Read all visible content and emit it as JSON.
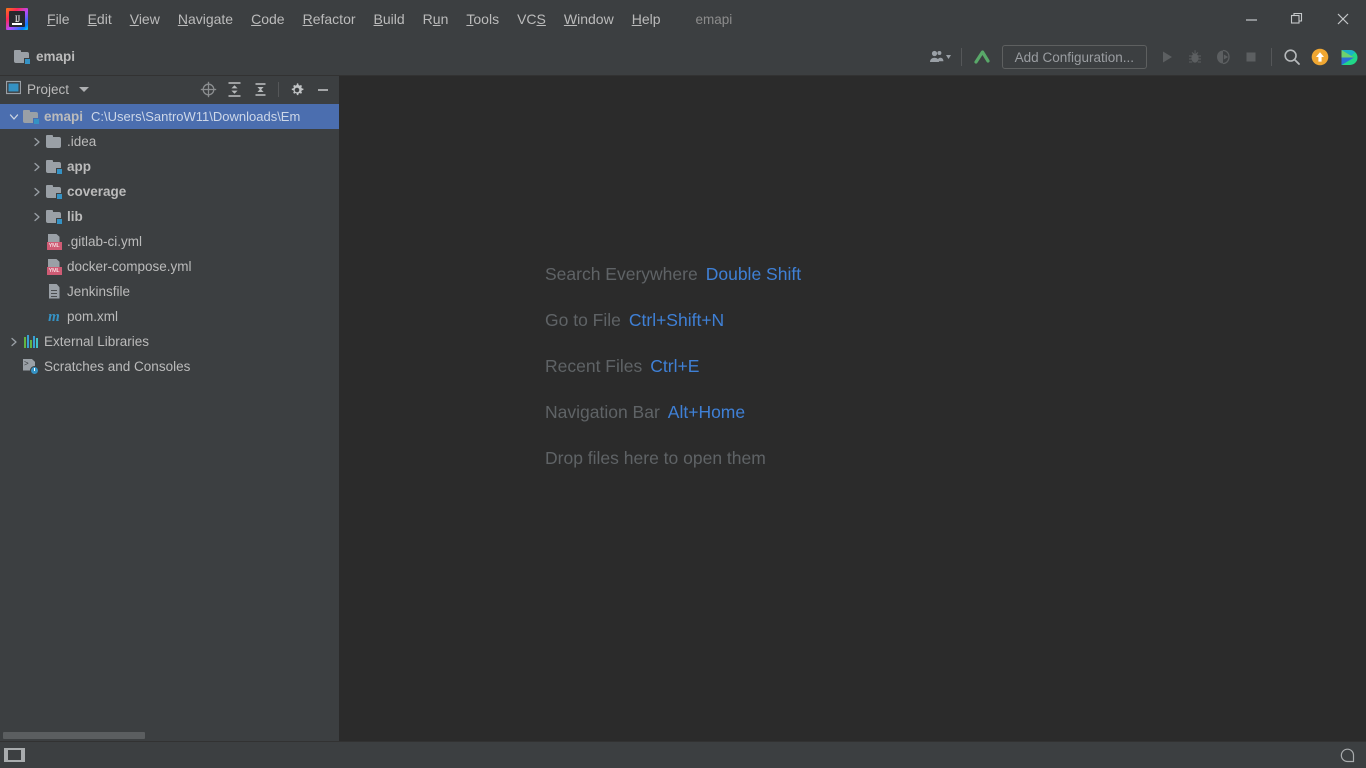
{
  "window": {
    "title": "emapi",
    "controls": [
      {
        "name": "minimize-button",
        "icon": "minimize-icon"
      },
      {
        "name": "restore-button",
        "icon": "restore-icon"
      },
      {
        "name": "close-button",
        "icon": "close-icon"
      }
    ]
  },
  "menubar": {
    "logo_alt": "intellij-idea-logo",
    "items": [
      {
        "label": "File",
        "mnemonic": "F"
      },
      {
        "label": "Edit",
        "mnemonic": "E"
      },
      {
        "label": "View",
        "mnemonic": "V"
      },
      {
        "label": "Navigate",
        "mnemonic": "N"
      },
      {
        "label": "Code",
        "mnemonic": "C"
      },
      {
        "label": "Refactor",
        "mnemonic": "R"
      },
      {
        "label": "Build",
        "mnemonic": "B"
      },
      {
        "label": "Run",
        "mnemonic": "u"
      },
      {
        "label": "Tools",
        "mnemonic": "T"
      },
      {
        "label": "VCS",
        "mnemonic": "S"
      },
      {
        "label": "Window",
        "mnemonic": "W"
      },
      {
        "label": "Help",
        "mnemonic": "H"
      }
    ]
  },
  "toolbar": {
    "project_chip_label": "emapi",
    "profile_icon": "user-profile-icon",
    "vcs_update_icon": "vcs-update-arrow-icon",
    "add_configuration_label": "Add Configuration...",
    "run_icon": "run-play-icon",
    "debug_icon": "debug-bug-icon",
    "coverage_icon": "run-with-coverage-icon",
    "stop_icon": "stop-square-icon",
    "search_icon": "search-icon",
    "update_icon": "ide-update-icon",
    "trainer_icon": "ide-features-trainer-icon"
  },
  "toolwindow": {
    "title": "Project",
    "caret_icon": "chevron-down-icon",
    "actions": [
      {
        "name": "select-opened-file-button",
        "icon": "locate-target-icon"
      },
      {
        "name": "expand-all-button",
        "icon": "expand-all-icon"
      },
      {
        "name": "collapse-all-button",
        "icon": "collapse-all-icon"
      },
      {
        "name": "options-button",
        "icon": "gear-icon"
      },
      {
        "name": "hide-button",
        "icon": "minimize-icon"
      }
    ]
  },
  "tree": {
    "nodes": [
      {
        "label": "emapi",
        "path": "C:\\Users\\SantroW11\\Downloads\\Em",
        "icon": "module-folder-icon",
        "indent": 0,
        "arrow": "expanded",
        "bold": true,
        "selected": true
      },
      {
        "label": ".idea",
        "path": "",
        "icon": "folder-icon",
        "indent": 1,
        "arrow": "collapsed",
        "bold": false,
        "selected": false
      },
      {
        "label": "app",
        "path": "",
        "icon": "module-folder-icon",
        "indent": 1,
        "arrow": "collapsed",
        "bold": true,
        "selected": false
      },
      {
        "label": "coverage",
        "path": "",
        "icon": "module-folder-icon",
        "indent": 1,
        "arrow": "collapsed",
        "bold": true,
        "selected": false
      },
      {
        "label": "lib",
        "path": "",
        "icon": "module-folder-icon",
        "indent": 1,
        "arrow": "collapsed",
        "bold": true,
        "selected": false
      },
      {
        "label": ".gitlab-ci.yml",
        "path": "",
        "icon": "yml-file-icon",
        "indent": 1,
        "arrow": "none",
        "bold": false,
        "selected": false
      },
      {
        "label": "docker-compose.yml",
        "path": "",
        "icon": "yml-file-icon",
        "indent": 1,
        "arrow": "none",
        "bold": false,
        "selected": false
      },
      {
        "label": "Jenkinsfile",
        "path": "",
        "icon": "text-file-icon",
        "indent": 1,
        "arrow": "none",
        "bold": false,
        "selected": false
      },
      {
        "label": "pom.xml",
        "path": "",
        "icon": "maven-file-icon",
        "indent": 1,
        "arrow": "none",
        "bold": false,
        "selected": false
      },
      {
        "label": "External Libraries",
        "path": "",
        "icon": "libraries-icon",
        "indent": 0,
        "arrow": "collapsed",
        "bold": false,
        "selected": false
      },
      {
        "label": "Scratches and Consoles",
        "path": "",
        "icon": "scratches-icon",
        "indent": 0,
        "arrow": "none",
        "bold": false,
        "selected": false
      }
    ]
  },
  "editor": {
    "hints": [
      {
        "action": "Search Everywhere",
        "shortcut": "Double Shift"
      },
      {
        "action": "Go to File",
        "shortcut": "Ctrl+Shift+N"
      },
      {
        "action": "Recent Files",
        "shortcut": "Ctrl+E"
      },
      {
        "action": "Navigation Bar",
        "shortcut": "Alt+Home"
      },
      {
        "action": "Drop files here to open them",
        "shortcut": ""
      }
    ]
  },
  "statusbar": {
    "toggle_toolwindows_icon": "toggle-tool-windows-icon",
    "notifications_icon": "notification-balloon-icon"
  },
  "colors": {
    "panel_bg": "#3c3f41",
    "editor_bg": "#2b2b2b",
    "selection_blue": "#4b6eaf",
    "shortcut_blue": "#3f80d6",
    "text": "#bbbbbb",
    "hint_text": "#5f6366",
    "accent_badge": "#3592c4",
    "yml_badge": "#cf5b74",
    "update_orange": "#f0a732",
    "vcs_green": "#59a869"
  }
}
